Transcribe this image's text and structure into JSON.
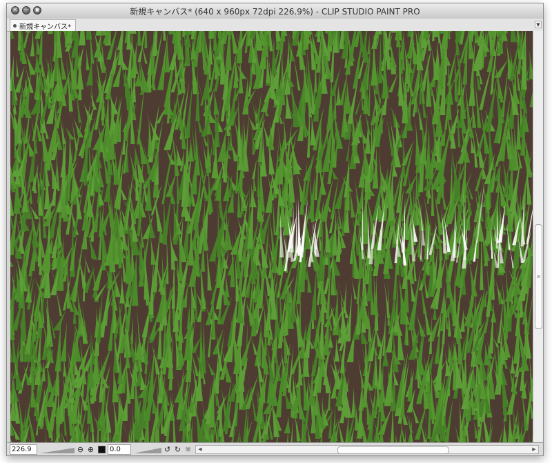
{
  "window": {
    "title": "新規キャンバス* (640 x 960px 72dpi 226.9%) - CLIP STUDIO PAINT PRO",
    "buttons": [
      {
        "name": "close-button",
        "icon": "close-icon",
        "glyph": "✕"
      },
      {
        "name": "minimize-button",
        "icon": "minimize-icon",
        "glyph": "−"
      },
      {
        "name": "maximize-button",
        "icon": "maximize-icon",
        "glyph": "■"
      }
    ]
  },
  "tabs": [
    {
      "label": "新規キャンバス*",
      "active": true
    }
  ],
  "status": {
    "zoom": "226.9",
    "rotation": "0.0",
    "icons": [
      "zoom-out-icon",
      "zoom-in-icon",
      "fit-icon",
      "rotate-left-icon",
      "rotate-right-icon",
      "reset-rotation-icon"
    ]
  },
  "canvas": {
    "description_colors": {
      "grass": "#4f8c2c",
      "soil": "#4e3b32",
      "highlight": "#ffffff"
    }
  },
  "colors": {
    "chrome": "#d6d6d6",
    "titlebar_top": "#ececec",
    "titlebar_bottom": "#c9c9c9"
  }
}
